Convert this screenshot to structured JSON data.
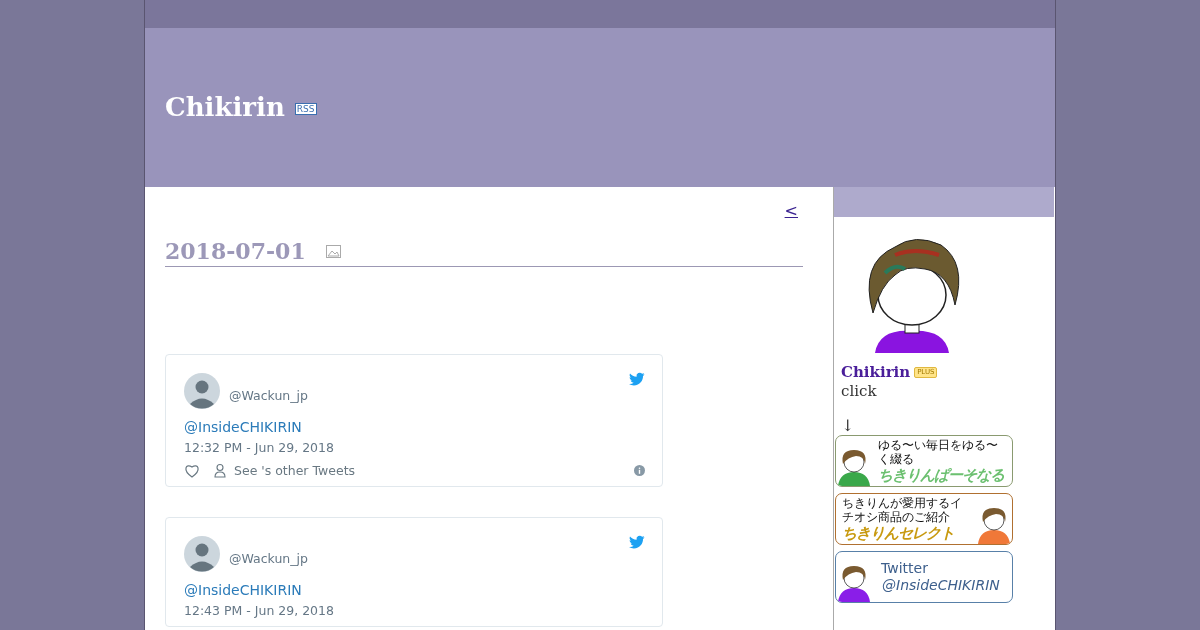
{
  "header": {
    "title": "Chikirin",
    "rss": "RSS"
  },
  "pager": {
    "prev": "<"
  },
  "entry": {
    "date": "2018-07-01"
  },
  "tweets": [
    {
      "handle": "@Wackun_jp",
      "text": "@InsideCHIKIRIN",
      "time": "12:32 PM - Jun 29, 2018",
      "other": "See 's other Tweets"
    },
    {
      "handle": "@Wackun_jp",
      "text": "@InsideCHIKIRIN",
      "time": "12:43 PM - Jun 29, 2018"
    }
  ],
  "sidebar": {
    "name": "Chikirin",
    "badge": "PLUS",
    "note": "click",
    "arrow": "↓",
    "banners": [
      {
        "kind": "left",
        "color": "#3aa84a",
        "sub": "ゆる〜い毎日をゆる〜く綴る",
        "main": "ちきりんぱーそなる"
      },
      {
        "kind": "right",
        "color": "#f07838",
        "sub": "ちきりんが愛用するイチオシ商品のご紹介",
        "main": "ちきりんセレクト"
      },
      {
        "kind": "twitter",
        "color": "#8a1ee8",
        "sub": "Twitter",
        "main": "@InsideCHIKIRIN"
      }
    ]
  }
}
